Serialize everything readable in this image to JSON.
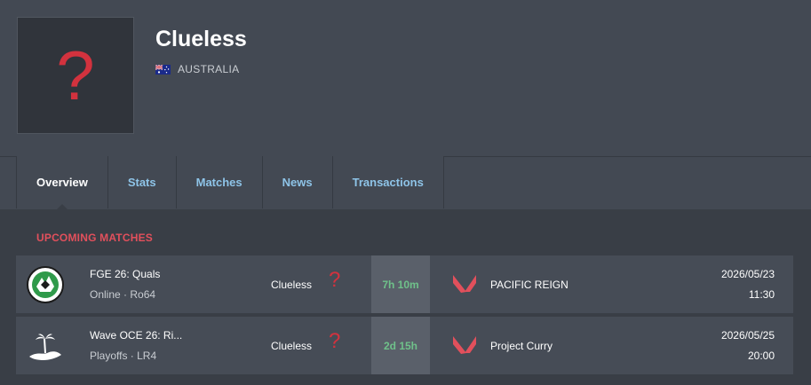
{
  "team": {
    "logo_glyph": "?",
    "name": "Clueless",
    "country": "AUSTRALIA",
    "flag_icon": "australia-flag-icon"
  },
  "tabs": [
    {
      "label": "Overview",
      "active": true
    },
    {
      "label": "Stats",
      "active": false
    },
    {
      "label": "Matches",
      "active": false
    },
    {
      "label": "News",
      "active": false
    },
    {
      "label": "Transactions",
      "active": false
    }
  ],
  "upcoming": {
    "title": "UPCOMING MATCHES",
    "matches": [
      {
        "event_logo_icon": "fge-event-logo-icon",
        "event_name": "FGE 26: Quals",
        "stage": "Online · Ro64",
        "team1": "Clueless",
        "team1_logo_glyph": "?",
        "countdown": "7h 10m",
        "team2_logo_icon": "valorant-logo-icon",
        "team2": "PACIFIC REIGN",
        "date": "2026/05/23",
        "time": "11:30"
      },
      {
        "event_logo_icon": "wave-oce-event-logo-icon",
        "event_name": "Wave OCE 26: Ri...",
        "stage": "Playoffs · LR4",
        "team1": "Clueless",
        "team1_logo_glyph": "?",
        "countdown": "2d 15h",
        "team2_logo_icon": "valorant-logo-icon",
        "team2": "Project Curry",
        "date": "2026/05/25",
        "time": "20:00"
      }
    ]
  },
  "colors": {
    "accent_red": "#e2505c",
    "tab_link": "#8ec4e8",
    "countdown_green": "#6fc18a"
  }
}
